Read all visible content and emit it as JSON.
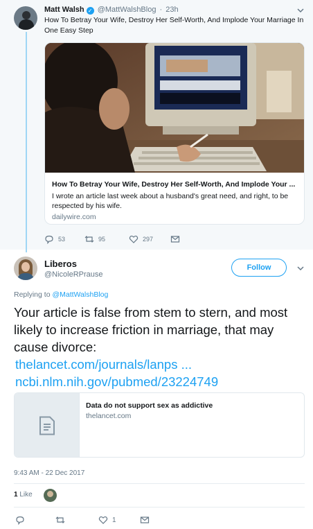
{
  "parent_tweet": {
    "author_name": "Matt Walsh",
    "author_handle": "@MattWalshBlog",
    "separator": "·",
    "time": "23h",
    "text": "How To Betray Your Wife, Destroy Her Self-Worth, And Implode Your Marriage In One Easy Step",
    "card": {
      "title": "How To Betray Your Wife, Destroy Her Self-Worth, And Implode Your ...",
      "description": "I wrote an article last week about a husband's great need, and right, to be respected by his wife.",
      "domain": "dailywire.com"
    },
    "actions": {
      "replies": "53",
      "retweets": "95",
      "likes": "297"
    }
  },
  "reply_tweet": {
    "author_name": "Liberos",
    "author_handle": "@NicoleRPrause",
    "follow_label": "Follow",
    "replying_to_prefix": "Replying to",
    "replying_to_handle": "@MattWalshBlog",
    "text": "Your article is false from stem to stern, and most likely to increase friction in marriage, that may cause divorce:",
    "links": [
      "thelancet.com/journals/lanps  ...",
      "ncbi.nlm.nih.gov/pubmed/23224749"
    ],
    "card": {
      "title": "Data do not support sex as addictive",
      "domain": "thelancet.com"
    },
    "timestamp": "9:43 AM - 22 Dec 2017",
    "like_count": "1",
    "like_label": "Like",
    "actions": {
      "likes": "1"
    }
  },
  "colors": {
    "accent": "#1da1f2",
    "muted": "#657786",
    "thread_line": "#9fd6f5"
  }
}
